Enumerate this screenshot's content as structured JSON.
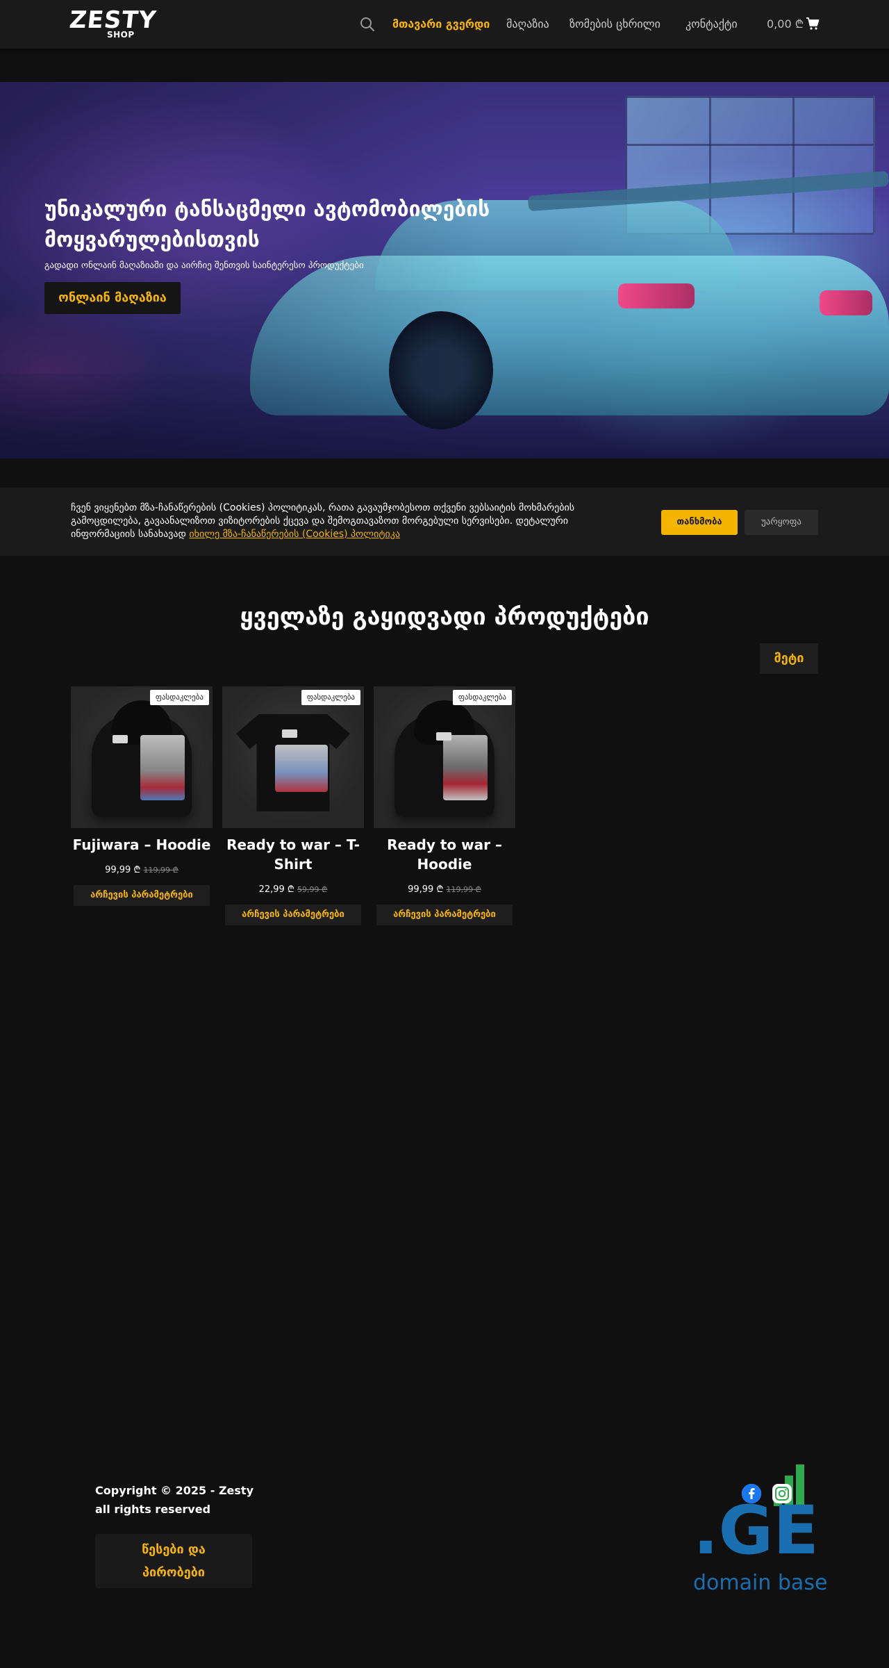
{
  "header": {
    "logo_main": "ZESTY",
    "logo_sub": "SHOP",
    "nav": [
      {
        "label": "მთავარი გვერდი",
        "active": true
      },
      {
        "label": "მაღაზია",
        "active": false
      },
      {
        "label": "ზომების ცხრილი",
        "active": false
      },
      {
        "label": "კონტაქტი",
        "active": false
      }
    ],
    "cart_total": "0,00 ₾",
    "icons": {
      "search": "search-icon",
      "cart": "cart-icon"
    }
  },
  "hero": {
    "title": "უნიკალური ტანსაცმელი ავტომობილების მოყვარულებისთვის",
    "subtitle": "გადადი ონლაინ მაღაზიაში და აირჩიე შენთვის საინტერესო პროდუქტები",
    "button": "ონლაინ მაღაზია"
  },
  "cookie": {
    "text": "ჩვენ ვიყენებთ მზა-ჩანაწერების (Cookies) პოლიტიკას, რათა გავაუმჯობესოთ თქვენი ვებსაიტის მოხმარების გამოცდილება, გავაანალიზოთ ვიზიტორების ქცევა და შემოგთავაზოთ მორგებული სერვისები. დეტალური ინფორმაციის სანახავად",
    "link": "იხილე მზა-ჩანაწერების (Cookies) პოლიტიკა",
    "accept": "თანხმობა",
    "decline": "უარყოფა"
  },
  "products": {
    "title": "ყველაზე გაყიდვადი პროდუქტები",
    "more": "მეტი",
    "items": [
      {
        "badge": "ფასდაკლება",
        "name": "Fujiwara – Hoodie",
        "price": "99,99 ₾",
        "old_price": "119,99 ₾",
        "button": "არჩევის პარამეტრები"
      },
      {
        "badge": "ფასდაკლება",
        "name": "Ready to war – T-Shirt",
        "price": "22,99 ₾",
        "old_price": "59,99 ₾",
        "button": "არჩევის პარამეტრები"
      },
      {
        "badge": "ფასდაკლება",
        "name": "Ready to war – Hoodie",
        "price": "99,99 ₾",
        "old_price": "119,99 ₾",
        "button": "არჩევის პარამეტრები"
      }
    ]
  },
  "footer": {
    "copyright_line1": "Copyright © 2025 - Zesty",
    "copyright_line2": "all rights reserved",
    "terms_line1": "წესები და",
    "terms_line2": "პირობები",
    "social": [
      "facebook-icon",
      "instagram-icon"
    ],
    "domain_logo_text": ".GE",
    "domain_logo_sub": "domain base"
  },
  "colors": {
    "accent": "#f4b400",
    "background": "#101010",
    "header_bg": "#1a1a1a",
    "domain_blue": "#1a6fb0",
    "domain_green": "#2fa84f"
  }
}
